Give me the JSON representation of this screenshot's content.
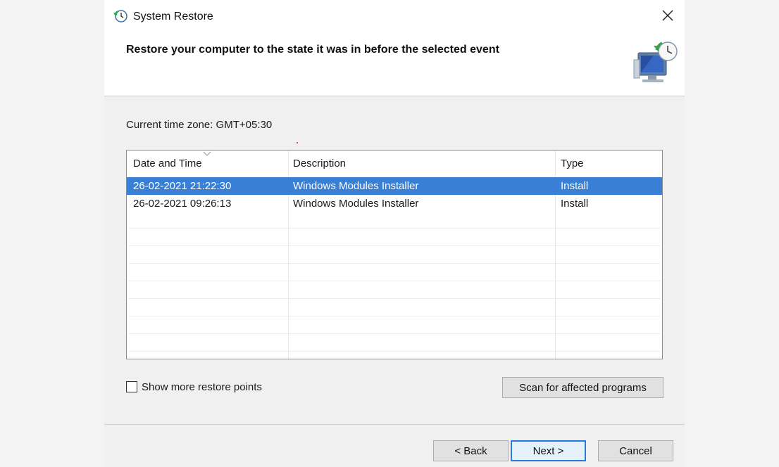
{
  "window": {
    "title": "System Restore",
    "heading": "Restore your computer to the state it was in before the selected event"
  },
  "timezone": "Current time zone: GMT+05:30",
  "table": {
    "columns": [
      "Date and Time",
      "Description",
      "Type"
    ],
    "rows": [
      {
        "date": "26-02-2021 21:22:30",
        "description": "Windows Modules Installer",
        "type": "Install",
        "selected": true
      },
      {
        "date": "26-02-2021 09:26:13",
        "description": "Windows Modules Installer",
        "type": "Install",
        "selected": false
      }
    ]
  },
  "checkbox": {
    "label": "Show more restore points",
    "checked": false
  },
  "buttons": {
    "scan": "Scan for affected programs",
    "back": "< Back",
    "next": "Next >",
    "cancel": "Cancel"
  },
  "icons": [
    "system-restore-icon",
    "close-icon",
    "restore-computer-icon",
    "sort-arrow-icon"
  ],
  "colors": {
    "selection": "#3a7fd6",
    "default_button_border": "#2a7ad7"
  }
}
